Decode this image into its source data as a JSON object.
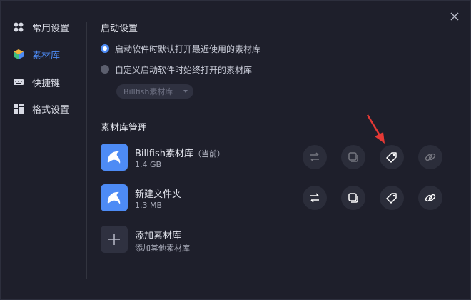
{
  "sidebar": {
    "items": [
      {
        "label": "常用设置",
        "icon": "general-settings-icon"
      },
      {
        "label": "素材库",
        "icon": "library-cube-icon"
      },
      {
        "label": "快捷键",
        "icon": "keyboard-icon"
      },
      {
        "label": "格式设置",
        "icon": "format-grid-icon"
      }
    ],
    "active_index": 1
  },
  "startup": {
    "title": "启动设置",
    "option_recent": "启动软件时默认打开最近使用的素材库",
    "option_custom": "自定义启动软件时始终打开的素材库",
    "selected": "option_recent",
    "dropdown_value": "Billfish素材库"
  },
  "library_management": {
    "title": "素材库管理",
    "libraries": [
      {
        "name": "Billfish素材库",
        "tag": "（当前）",
        "size": "1.4 GB",
        "actions_enabled": false
      },
      {
        "name": "新建文件夹",
        "tag": "",
        "size": "1.3 MB",
        "actions_enabled": true
      }
    ],
    "add": {
      "title": "添加素材库",
      "subtitle": "添加其他素材库"
    }
  },
  "colors": {
    "accent": "#4d8bf5",
    "background": "#1e1f2b",
    "annotation_arrow": "#e53935"
  }
}
